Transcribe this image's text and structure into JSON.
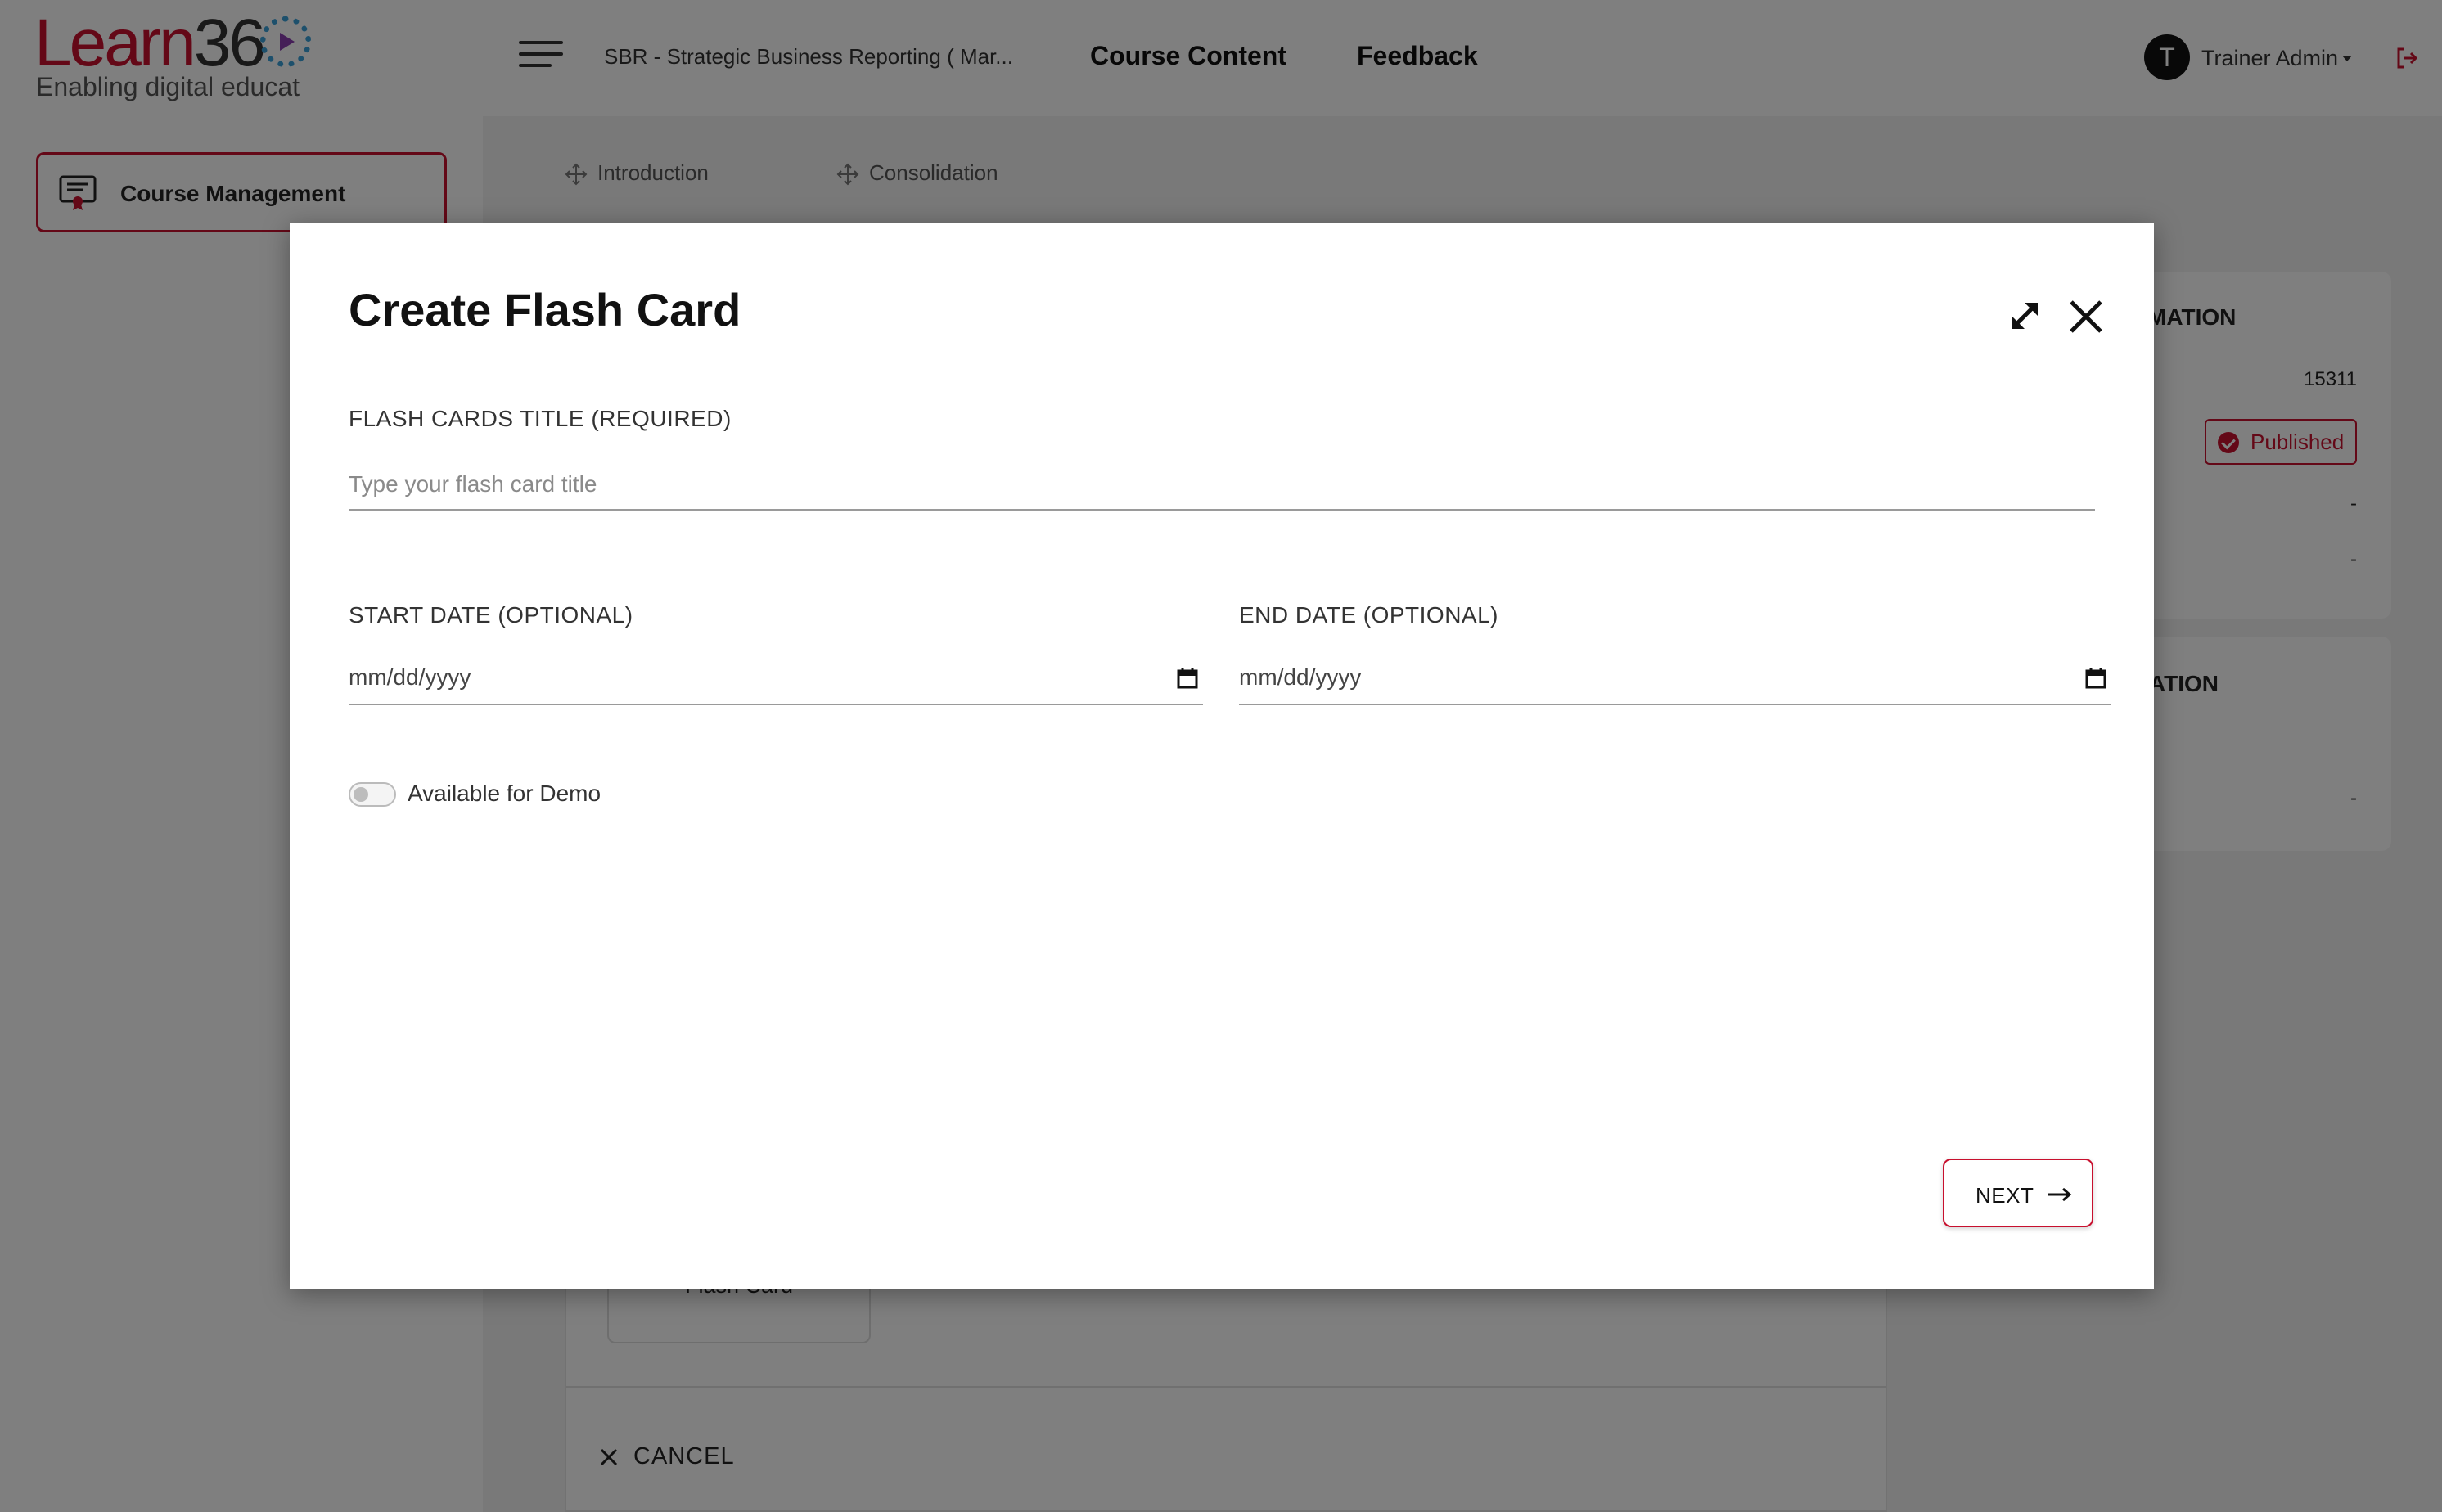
{
  "brand": {
    "logo_word_learn": "Learn",
    "logo_word_num": "36",
    "tagline": "Enabling digital educat",
    "accent_color": "#c8102e"
  },
  "header": {
    "course_title": "SBR - Strategic Business Reporting ( Mar...",
    "nav": {
      "course_content": "Course Content",
      "feedback": "Feedback"
    },
    "user": {
      "initial": "T",
      "name": "Trainer Admin"
    }
  },
  "sidebar": {
    "items": [
      {
        "label": "Course Management",
        "icon": "certificate-icon"
      }
    ]
  },
  "content_tabs": [
    {
      "label": "Introduction",
      "icon": "move-icon"
    },
    {
      "label": "Consolidation",
      "icon": "move-icon"
    }
  ],
  "info_panel": {
    "card1": {
      "heading": "MATION",
      "id_value": "15311",
      "status": "Published",
      "row3": "-",
      "row4": "-"
    },
    "card2": {
      "heading": "ATION",
      "row1": "-"
    }
  },
  "builder": {
    "tile_label": "Flash Card",
    "cancel_label": "CANCEL"
  },
  "modal": {
    "title": "Create Flash Card",
    "title_label": "FLASH CARDS TITLE (REQUIRED)",
    "title_placeholder": "Type your flash card title",
    "start_label": "START DATE (OPTIONAL)",
    "end_label": "END DATE (OPTIONAL)",
    "date_placeholder": "mm/dd/yyyy",
    "demo_toggle_label": "Available for Demo",
    "demo_toggle_on": false,
    "next_label": "NEXT"
  }
}
